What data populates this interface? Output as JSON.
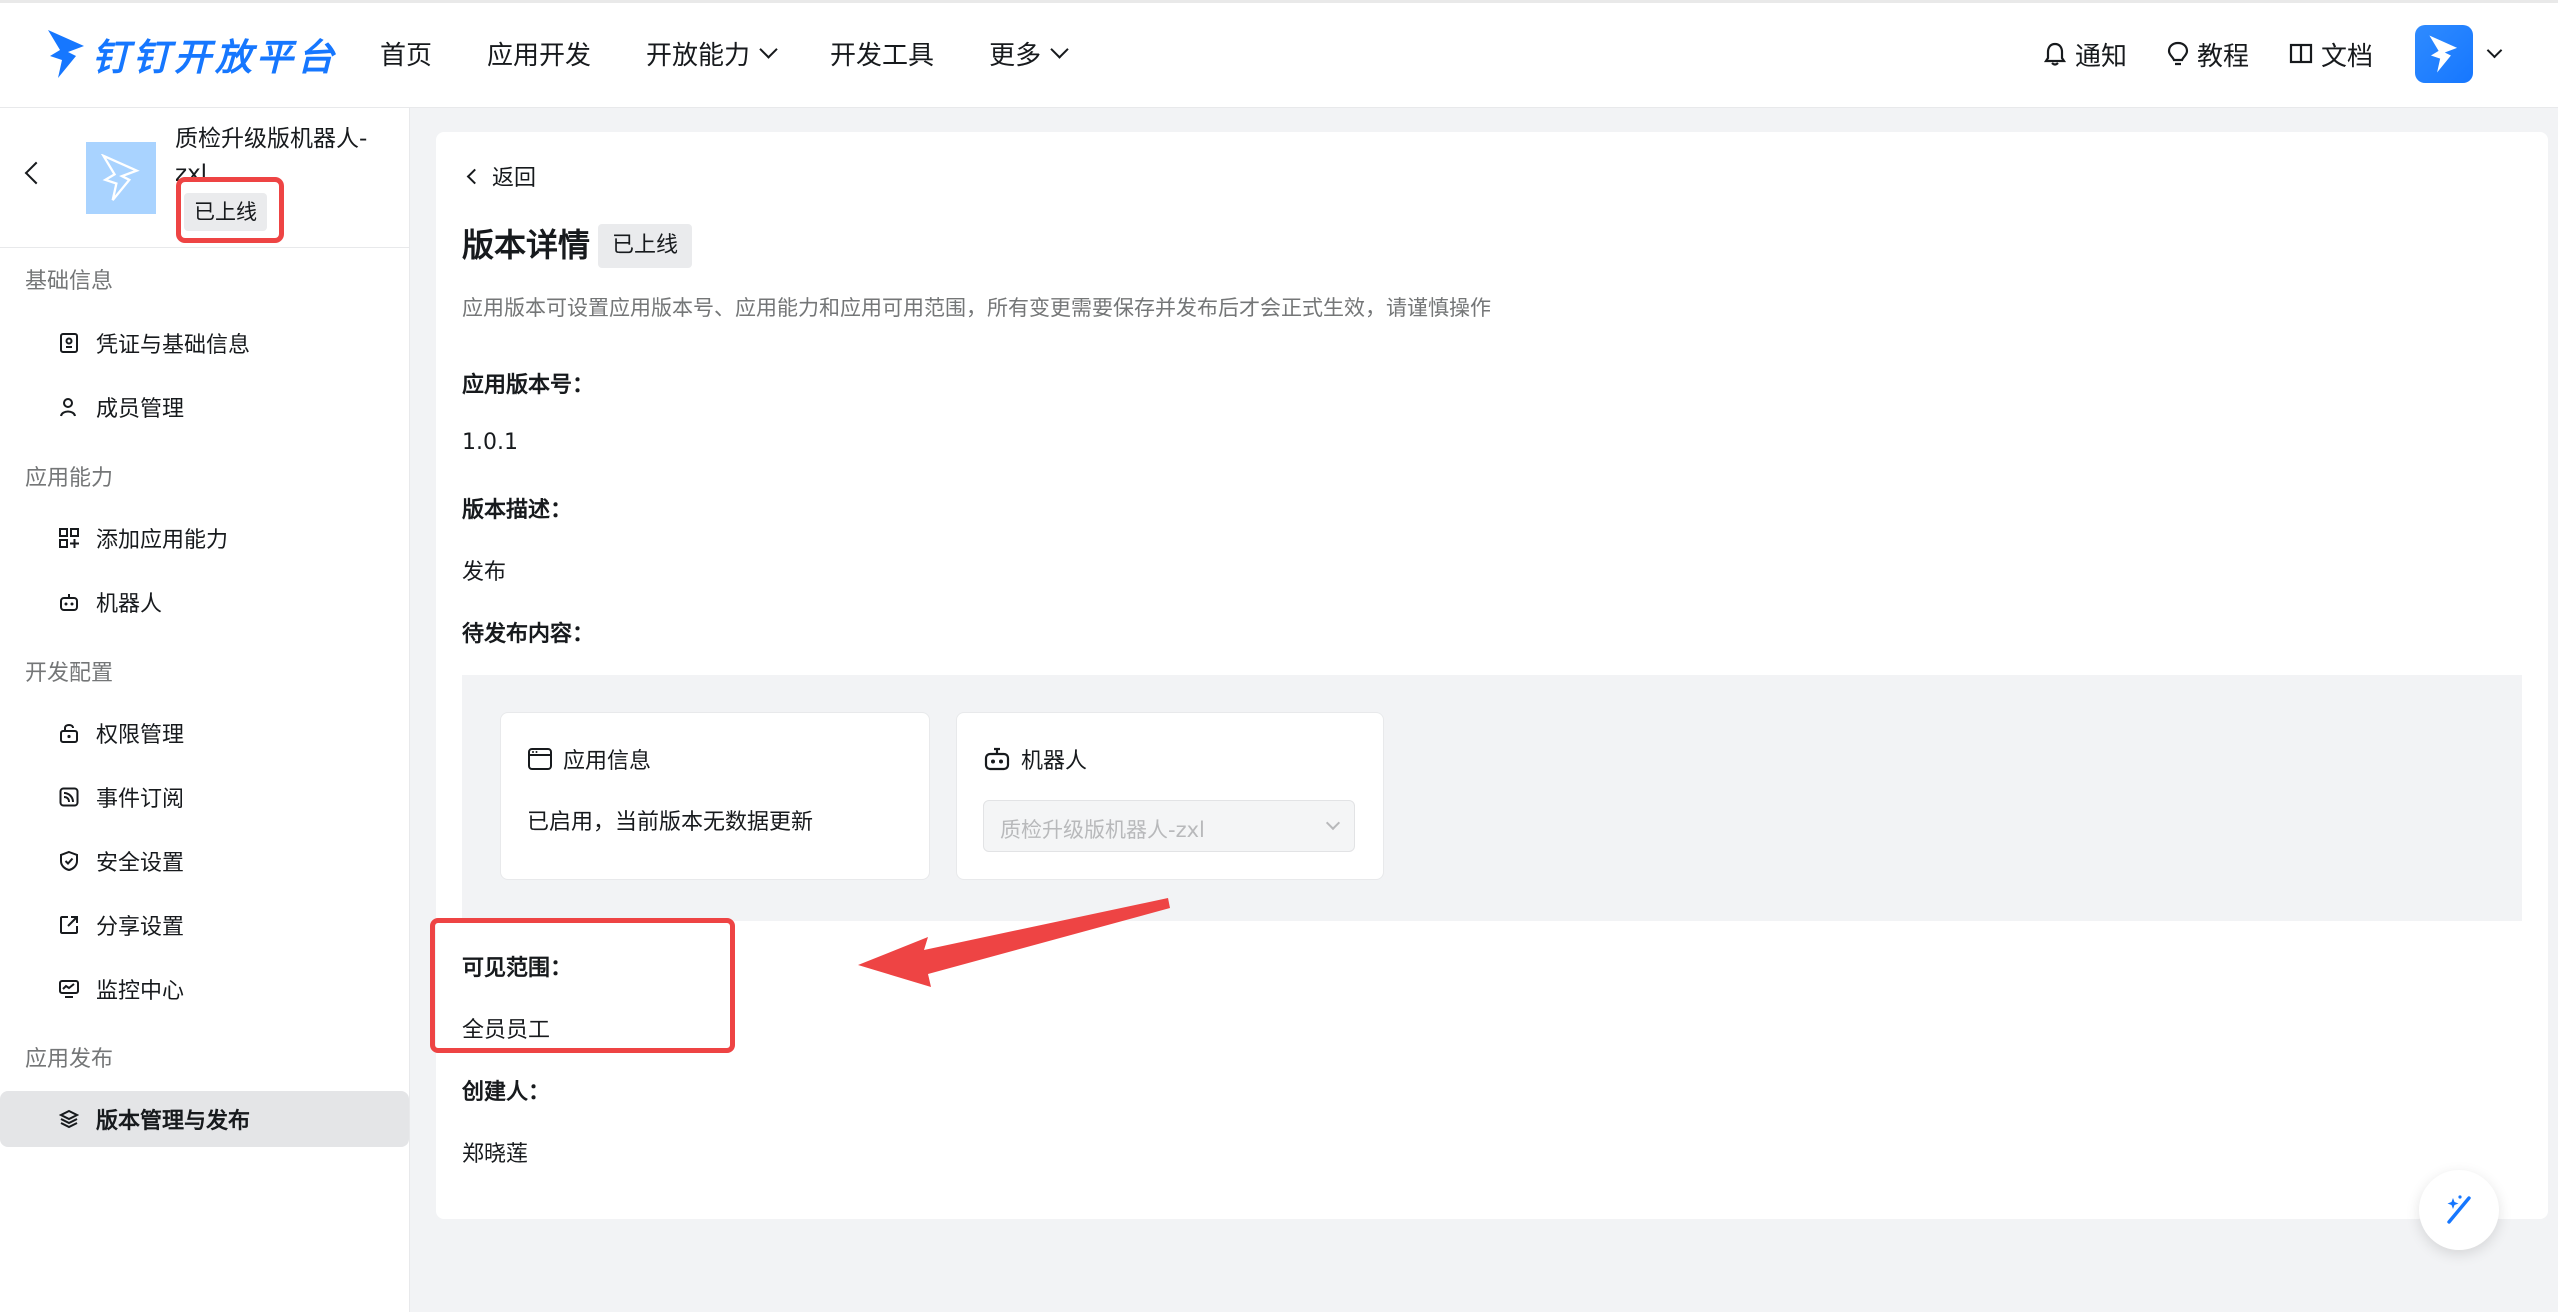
{
  "brand": {
    "name": "钉钉开放平台",
    "color": "#1677ff"
  },
  "nav": {
    "items": [
      {
        "label": "首页",
        "has_dropdown": false
      },
      {
        "label": "应用开发",
        "has_dropdown": false
      },
      {
        "label": "开放能力",
        "has_dropdown": true
      },
      {
        "label": "开发工具",
        "has_dropdown": false
      },
      {
        "label": "更多",
        "has_dropdown": true
      }
    ],
    "tools": [
      {
        "label": "通知",
        "icon": "bell-icon"
      },
      {
        "label": "教程",
        "icon": "bulb-icon"
      },
      {
        "label": "文档",
        "icon": "book-icon"
      }
    ]
  },
  "sidebar": {
    "app": {
      "name": "质检升级版机器人-zxl",
      "status": "已上线"
    },
    "groups": [
      {
        "title": "基础信息",
        "items": [
          {
            "label": "凭证与基础信息",
            "icon": "credential-icon"
          },
          {
            "label": "成员管理",
            "icon": "user-icon"
          }
        ]
      },
      {
        "title": "应用能力",
        "items": [
          {
            "label": "添加应用能力",
            "icon": "add-capability-icon"
          },
          {
            "label": "机器人",
            "icon": "robot-icon"
          }
        ]
      },
      {
        "title": "开发配置",
        "items": [
          {
            "label": "权限管理",
            "icon": "lock-icon"
          },
          {
            "label": "事件订阅",
            "icon": "rss-icon"
          },
          {
            "label": "安全设置",
            "icon": "shield-icon"
          },
          {
            "label": "分享设置",
            "icon": "share-icon"
          },
          {
            "label": "监控中心",
            "icon": "monitor-icon"
          }
        ]
      },
      {
        "title": "应用发布",
        "items": [
          {
            "label": "版本管理与发布",
            "icon": "layers-icon",
            "active": true
          }
        ]
      }
    ]
  },
  "main": {
    "back_label": "返回",
    "title": "版本详情",
    "status": "已上线",
    "description": "应用版本可设置应用版本号、应用能力和应用可用范围，所有变更需要保存并发布后才会正式生效，请谨慎操作",
    "fields": {
      "version_label": "应用版本号：",
      "version_value": "1.0.1",
      "desc_label": "版本描述：",
      "desc_value": "发布",
      "pending_label": "待发布内容：",
      "scope_label": "可见范围：",
      "scope_value": "全员员工",
      "creator_label": "创建人：",
      "creator_value": "郑晓莲"
    },
    "pending": {
      "app_info": {
        "title": "应用信息",
        "text": "已启用，当前版本无数据更新"
      },
      "robot": {
        "title": "机器人",
        "select_value": "质检升级版机器人-zxl"
      }
    }
  },
  "annotation_color": "#ee4444"
}
